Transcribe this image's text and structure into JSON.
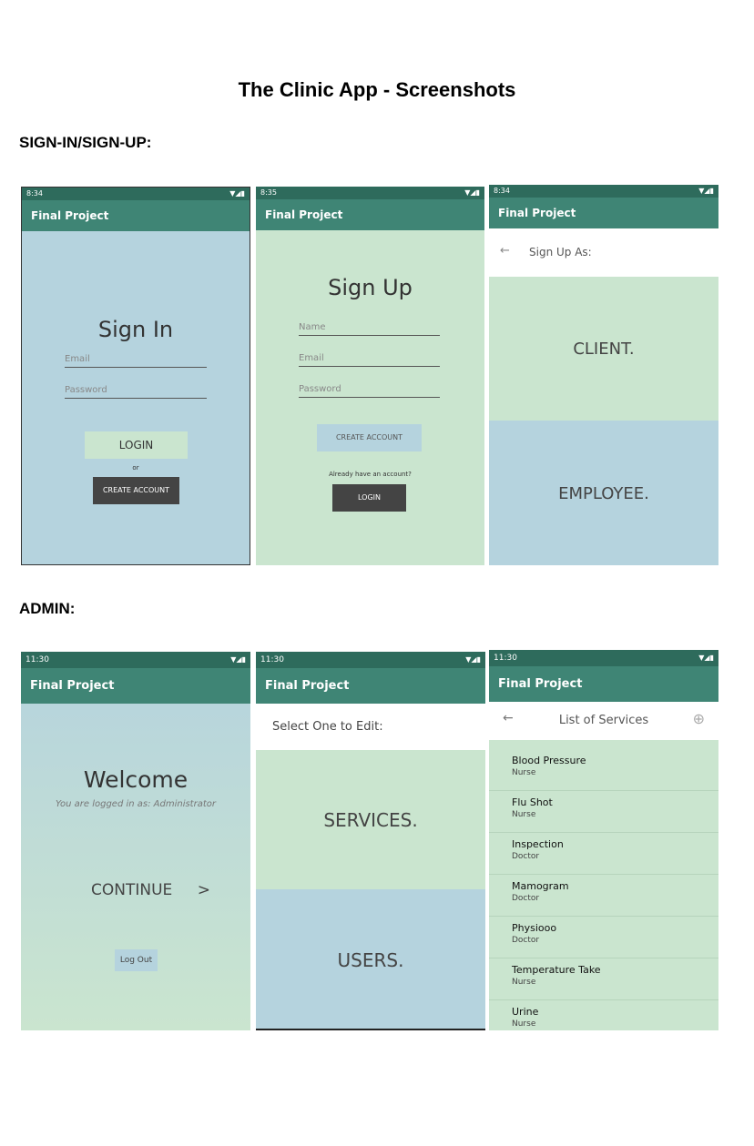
{
  "doc": {
    "title": "The Clinic App - Screenshots",
    "section1": "SIGN-IN/SIGN-UP:",
    "section2": "ADMIN:"
  },
  "colors": {
    "statusbar": "#2e6b5c",
    "appbar": "#3f8575",
    "blue_bg": "#b5d3de",
    "green_bg": "#cae5cf",
    "dark_button": "#444444"
  },
  "screens": {
    "signin": {
      "time": "8:34",
      "app_title": "Final Project",
      "heading": "Sign In",
      "email_placeholder": "Email",
      "password_placeholder": "Password",
      "login_label": "LOGIN",
      "or_label": "or",
      "create_label": "CREATE ACCOUNT"
    },
    "signup": {
      "time": "8:35",
      "app_title": "Final Project",
      "heading": "Sign Up",
      "name_placeholder": "Name",
      "email_placeholder": "Email",
      "password_placeholder": "Password",
      "create_label": "CREATE ACCOUNT",
      "already_label": "Already have an account?",
      "login_label": "LOGIN"
    },
    "signup_as": {
      "time": "8:34",
      "app_title": "Final Project",
      "header": "Sign Up As:",
      "client_label": "CLIENT.",
      "employee_label": "EMPLOYEE."
    },
    "welcome": {
      "time": "11:30",
      "app_title": "Final Project",
      "heading": "Welcome",
      "logged_in": "You are logged in as: Administrator",
      "continue_label": "CONTINUE",
      "continue_arrow": ">",
      "logout_label": "Log Out"
    },
    "select_edit": {
      "time": "11:30",
      "app_title": "Final Project",
      "header": "Select One to Edit:",
      "services_label": "SERVICES.",
      "users_label": "USERS."
    },
    "services_list": {
      "time": "11:30",
      "app_title": "Final Project",
      "header": "List of Services",
      "items": [
        {
          "name": "Blood Pressure",
          "role": "Nurse"
        },
        {
          "name": "Flu Shot",
          "role": "Nurse"
        },
        {
          "name": "Inspection",
          "role": "Doctor"
        },
        {
          "name": "Mamogram",
          "role": "Doctor"
        },
        {
          "name": "Physiooo",
          "role": "Doctor"
        },
        {
          "name": "Temperature Take",
          "role": "Nurse"
        },
        {
          "name": "Urine",
          "role": "Nurse"
        }
      ]
    }
  },
  "icons": {
    "back": "arrow-left-icon",
    "add": "plus-circle-icon"
  }
}
